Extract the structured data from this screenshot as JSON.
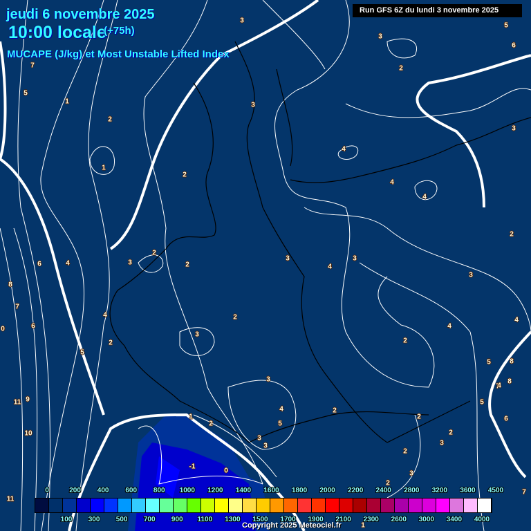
{
  "header": {
    "date": "jeudi 6 novembre 2025",
    "time": "10:00 locale",
    "lead": "(+75h)",
    "parameter": "MUCAPE (J/kg) et Most Unstable Lifted Index",
    "run": "Run GFS 6Z du lundi 3 novembre 2025"
  },
  "contour_labels": [
    "3",
    "5",
    "6",
    "3",
    "2",
    "7",
    "5",
    "1",
    "2",
    "3",
    "3",
    "1",
    "2",
    "4",
    "4",
    "4",
    "2",
    "6",
    "4",
    "3",
    "2",
    "2",
    "3",
    "3",
    "4",
    "3",
    "8",
    "7",
    "6",
    "4",
    "2",
    "4",
    "4",
    "2",
    "0",
    "5",
    "3",
    "2",
    "3",
    "5",
    "8",
    "7",
    "8",
    "11",
    "9",
    "10",
    "1",
    "2",
    "4",
    "5",
    "3",
    "3",
    "2",
    "2",
    "2",
    "3",
    "2",
    "5",
    "6",
    "-1",
    "0",
    "2",
    "3",
    "11",
    "7",
    "4",
    "1"
  ],
  "colorbar": {
    "colors": [
      "#000c40",
      "#00306a",
      "#003399",
      "#0000cc",
      "#0000ff",
      "#0033ff",
      "#0099ff",
      "#33ccff",
      "#66ffff",
      "#66ff99",
      "#66ff66",
      "#66ff00",
      "#ccff00",
      "#ffff00",
      "#ffff88",
      "#ffdd44",
      "#ffcc00",
      "#ff9900",
      "#ff6600",
      "#ff3333",
      "#ff3300",
      "#ff0000",
      "#dd0000",
      "#aa0000",
      "#aa0033",
      "#aa0066",
      "#aa00aa",
      "#cc00cc",
      "#dd00dd",
      "#ff00ff",
      "#dd77dd",
      "#ffbbff",
      "#ffffff"
    ],
    "top_labels": [
      "0",
      "200",
      "400",
      "600",
      "800",
      "1000",
      "1200",
      "1400",
      "1600",
      "1800",
      "2000",
      "2200",
      "2400",
      "2800",
      "3200",
      "3600",
      "4500"
    ],
    "bottom_labels": [
      "100",
      "300",
      "500",
      "700",
      "900",
      "1100",
      "1300",
      "1500",
      "1700",
      "1900",
      "2100",
      "2300",
      "2600",
      "3000",
      "3400",
      "4000"
    ]
  },
  "copyright": "Copyright 2025 Meteociel.fr"
}
